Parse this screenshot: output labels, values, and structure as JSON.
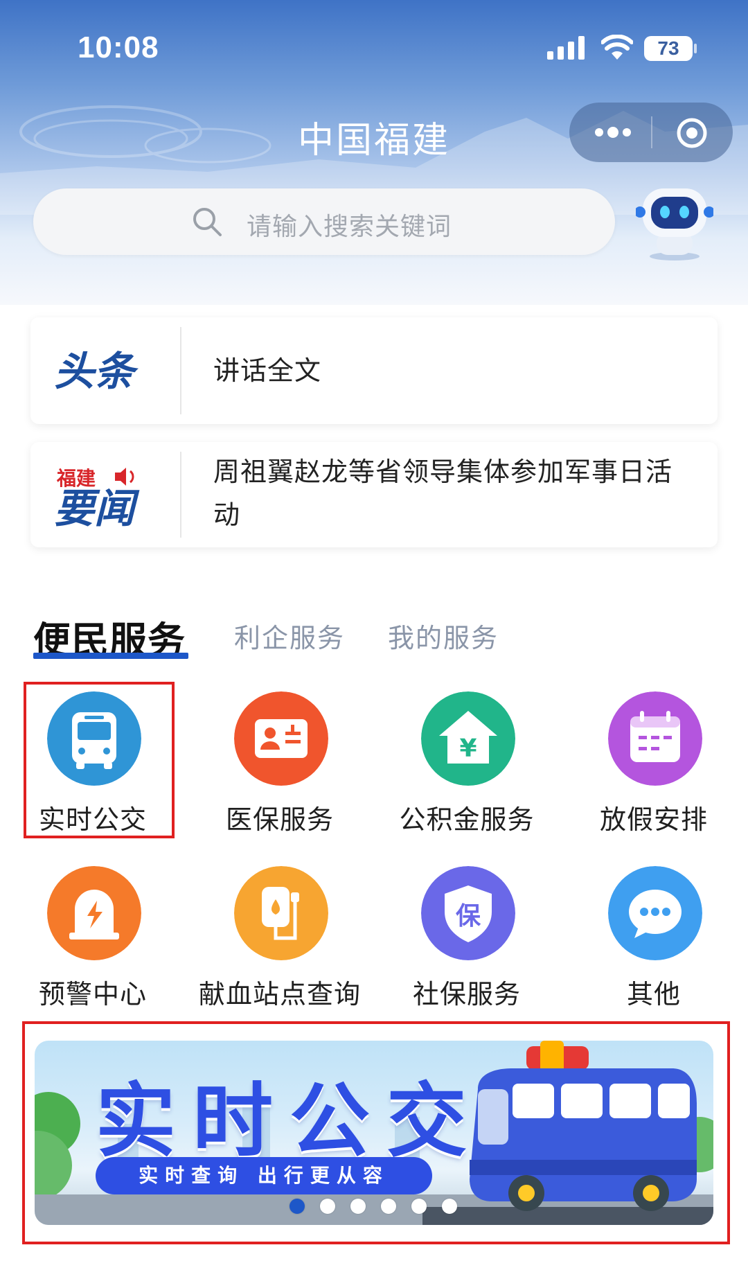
{
  "status_bar": {
    "time": "10:08",
    "battery": "73"
  },
  "header": {
    "title": "中国福建"
  },
  "search": {
    "placeholder": "请输入搜索关键词"
  },
  "news": [
    {
      "logo": "头条",
      "text": "讲话全文"
    },
    {
      "logo_top": "福建",
      "logo_bottom": "要闻",
      "text_line1": "周祖翼赵龙等省领导集体参加军事日活",
      "text_line2": "动"
    }
  ],
  "tabs": [
    {
      "label": "便民服务",
      "active": true
    },
    {
      "label": "利企服务",
      "active": false
    },
    {
      "label": "我的服务",
      "active": false
    }
  ],
  "services": [
    {
      "label": "实时公交",
      "icon": "bus-icon",
      "color": "#2f95d6"
    },
    {
      "label": "医保服务",
      "icon": "id-card-icon",
      "color": "#f0552d"
    },
    {
      "label": "公积金服务",
      "icon": "house-yen-icon",
      "color": "#21b58a"
    },
    {
      "label": "放假安排",
      "icon": "calendar-icon",
      "color": "#b455de"
    },
    {
      "label": "预警中心",
      "icon": "alarm-icon",
      "color": "#f57a2a"
    },
    {
      "label": "献血站点查询",
      "icon": "blood-bag-icon",
      "color": "#f7a531"
    },
    {
      "label": "社保服务",
      "icon": "shield-bao-icon",
      "color": "#6a68e8"
    },
    {
      "label": "其他",
      "icon": "more-dots-icon",
      "color": "#3f9ff0"
    }
  ],
  "banner": {
    "title": "实时公交",
    "subtitle": "实时查询 出行更从容",
    "slide_count": 6,
    "active_slide": 1
  },
  "colors": {
    "accent": "#1d57c8",
    "highlight": "#e02020"
  }
}
